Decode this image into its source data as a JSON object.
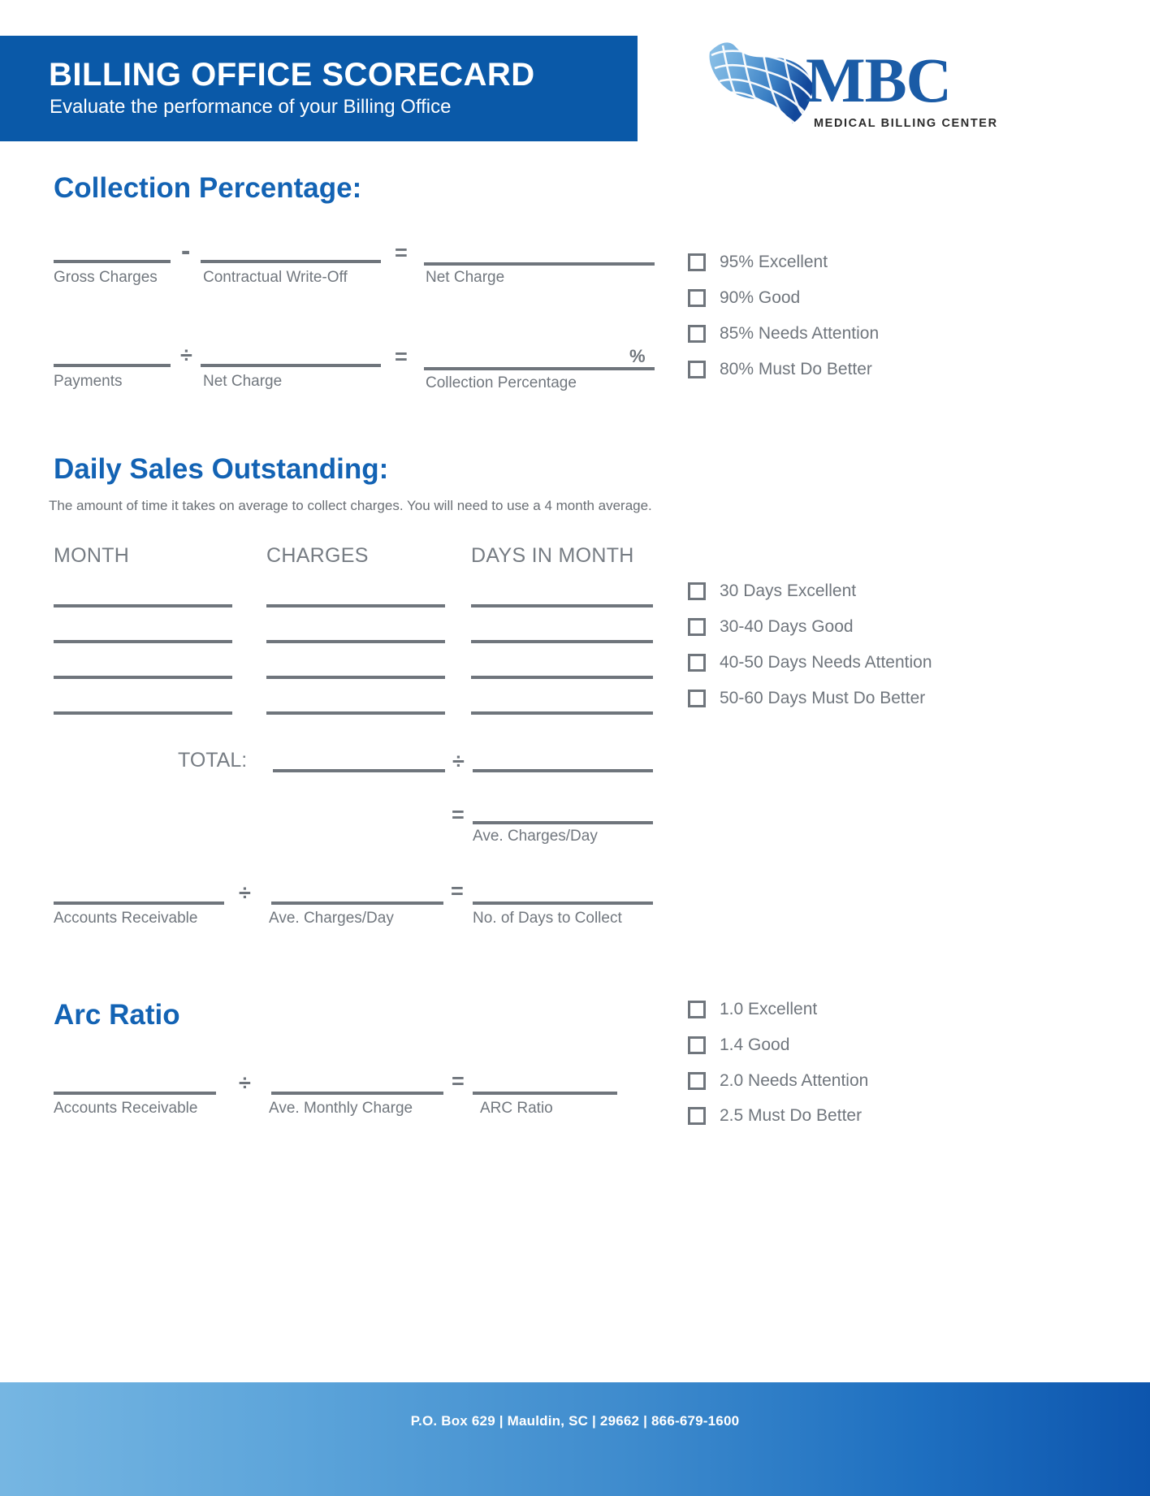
{
  "header": {
    "title": "BILLING OFFICE SCORECARD",
    "subtitle": "Evaluate the performance of your Billing Office",
    "brand_color": "#0a59a8"
  },
  "logo": {
    "mark": "flag-grid-logo",
    "wordmark": "MBC",
    "tagline": "MEDICAL BILLING CENTER",
    "color": "#1a5ba6"
  },
  "sections": {
    "collection": {
      "title": "Collection Percentage:",
      "row1": {
        "op1": "-",
        "op2": "=",
        "labels": [
          "Gross Charges",
          "Contractual Write-Off",
          "Net Charge"
        ]
      },
      "row2": {
        "op1": "÷",
        "op2": "=",
        "labels": [
          "Payments",
          "Net Charge",
          "Collection Percentage"
        ],
        "suffix": "%"
      },
      "checkboxes": [
        "95% Excellent",
        "90% Good",
        "85% Needs Attention",
        "80% Must Do Better"
      ]
    },
    "dso": {
      "title": "Daily Sales Outstanding:",
      "description": "The amount of time it takes on average to collect charges. You will need to use a 4 month average.",
      "columns": [
        "MONTH",
        "CHARGES",
        "DAYS IN MONTH"
      ],
      "row_count": 4,
      "total_label": "TOTAL:",
      "total_op": "÷",
      "equals_op": "=",
      "result_label": "Ave. Charges/Day",
      "final_row": {
        "op1": "÷",
        "op2": "=",
        "labels": [
          "Accounts Receivable",
          "Ave. Charges/Day",
          "No. of Days to Collect"
        ]
      },
      "checkboxes": [
        "30 Days Excellent",
        "30-40 Days Good",
        "40-50 Days Needs Attention",
        "50-60 Days Must Do Better"
      ]
    },
    "arc": {
      "title": "Arc Ratio",
      "row": {
        "op1": "÷",
        "op2": "=",
        "labels": [
          "Accounts Receivable",
          "Ave. Monthly Charge",
          "ARC Ratio"
        ]
      },
      "checkboxes": [
        "1.0 Excellent",
        "1.4 Good",
        "2.0 Needs Attention",
        "2.5 Must Do Better"
      ]
    }
  },
  "footer": {
    "text": "P.O. Box 629 | Mauldin, SC | 29662 | 866-679-1600"
  }
}
